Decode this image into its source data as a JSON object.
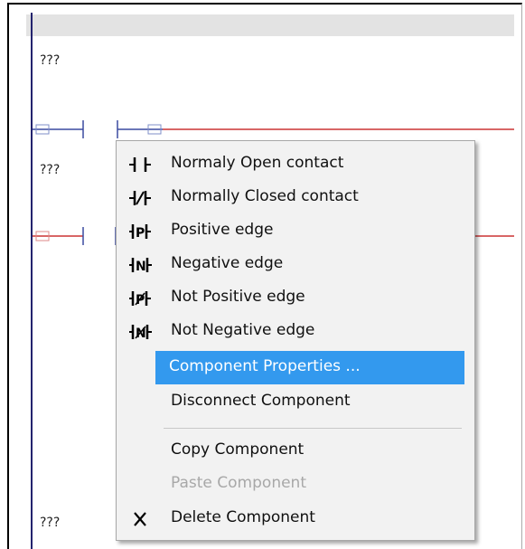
{
  "rungs": [
    {
      "label": "???"
    },
    {
      "label": "???"
    },
    {
      "label": "???"
    }
  ],
  "context_menu": {
    "items": [
      {
        "label": "Normaly Open contact",
        "icon": "normally-open-contact-icon",
        "state": "normal"
      },
      {
        "label": "Normally Closed contact",
        "icon": "normally-closed-contact-icon",
        "state": "normal"
      },
      {
        "label": "Positive edge",
        "icon": "positive-edge-icon",
        "state": "normal"
      },
      {
        "label": "Negative edge",
        "icon": "negative-edge-icon",
        "state": "normal"
      },
      {
        "label": "Not Positive edge",
        "icon": "not-positive-edge-icon",
        "state": "normal"
      },
      {
        "label": "Not Negative edge",
        "icon": "not-negative-edge-icon",
        "state": "normal"
      },
      {
        "label": "Component Properties ...",
        "icon": "",
        "state": "selected"
      },
      {
        "label": "Disconnect Component",
        "icon": "",
        "state": "normal"
      },
      {
        "label": "Copy Component",
        "icon": "",
        "state": "normal"
      },
      {
        "label": "Paste Component",
        "icon": "",
        "state": "disabled"
      },
      {
        "label": "Delete Component",
        "icon": "delete-x-icon",
        "state": "normal"
      }
    ]
  },
  "colors": {
    "rail": "#23236e",
    "wire_blue": "#3a4aa0",
    "wire_red": "#cc3333",
    "selection": "#3399ee",
    "menu_bg": "#f2f2f2"
  }
}
